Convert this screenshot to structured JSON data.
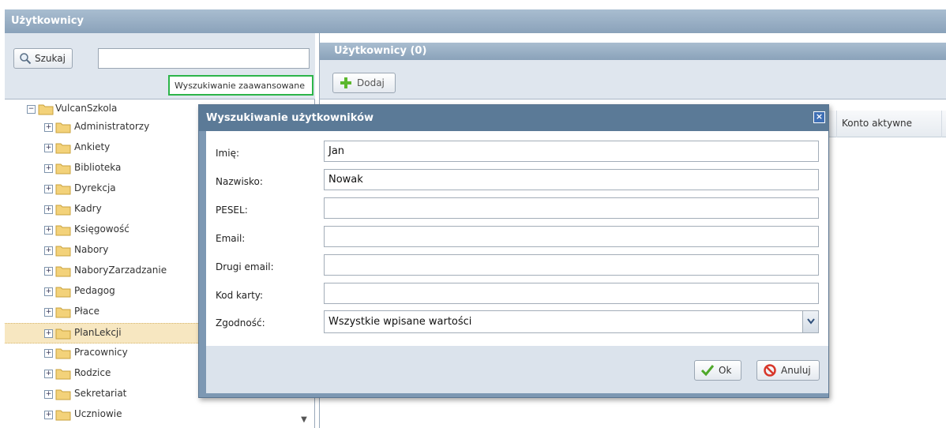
{
  "app": {
    "title": "Użytkownicy"
  },
  "left": {
    "search_button_label": "Szukaj",
    "search_input_value": "",
    "advanced_search_label": "Wyszukiwanie zaawansowane",
    "tree": {
      "root": "VulcanSzkola",
      "items": [
        "Administratorzy",
        "Ankiety",
        "Biblioteka",
        "Dyrekcja",
        "Kadry",
        "Księgowość",
        "Nabory",
        "NaboryZarzadzanie",
        "Pedagog",
        "Płace",
        "PlanLekcji",
        "Pracownicy",
        "Rodzice",
        "Sekretariat",
        "Uczniowie"
      ],
      "selected": "PlanLekcji"
    }
  },
  "right": {
    "header_title": "Użytkownicy (0)",
    "add_button_label": "Dodaj",
    "column_account_active": "Konto aktywne"
  },
  "dialog": {
    "title": "Wyszukiwanie użytkowników",
    "close_label": "×",
    "fields": [
      {
        "label": "Imię:",
        "value": "Jan"
      },
      {
        "label": "Nazwisko:",
        "value": "Nowak"
      },
      {
        "label": "PESEL:",
        "value": ""
      },
      {
        "label": "Email:",
        "value": ""
      },
      {
        "label": "Drugi email:",
        "value": ""
      },
      {
        "label": "Kod karty:",
        "value": ""
      }
    ],
    "match_label": "Zgodność:",
    "match_value": "Wszystkie wpisane wartości",
    "ok_label": "Ok",
    "cancel_label": "Anuluj"
  },
  "colors": {
    "header": "#8aa2ba",
    "dialog_title": "#5b7a97",
    "selected_row": "#f7e7c1",
    "advanced_border": "#2db54a"
  }
}
